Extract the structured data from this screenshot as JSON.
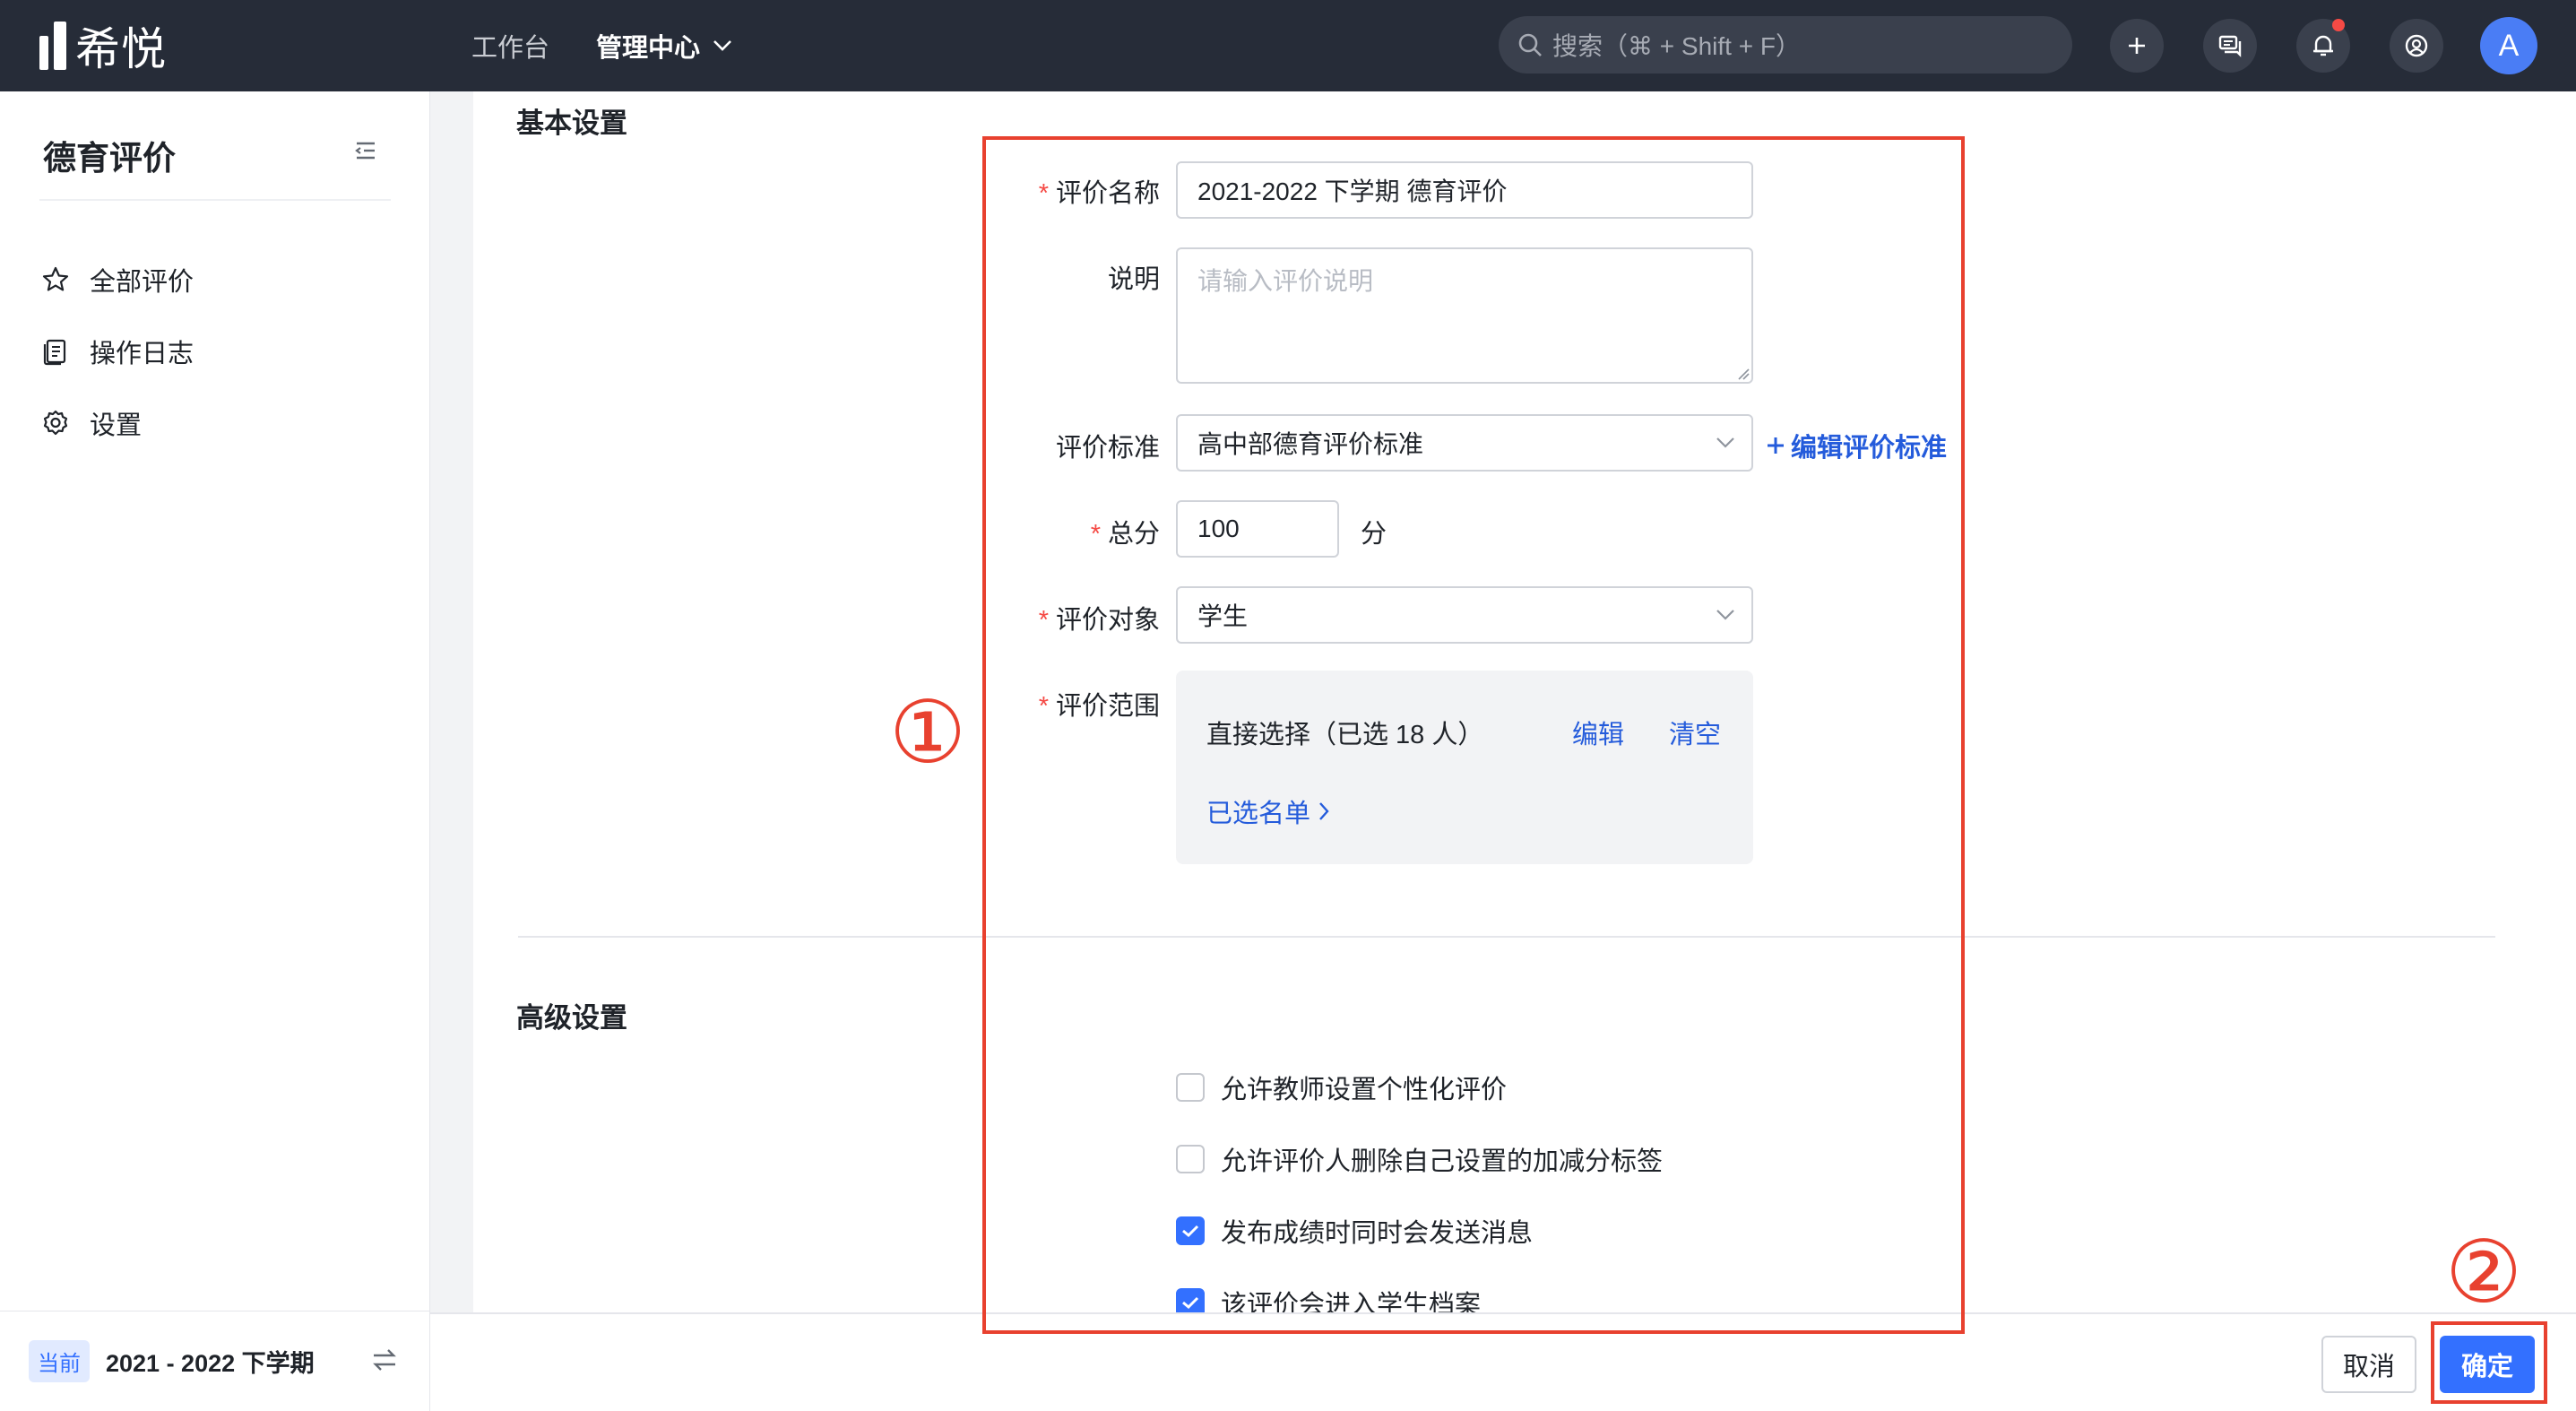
{
  "app": {
    "logo_text": "希悦"
  },
  "nav": {
    "workbench": "工作台",
    "admin": "管理中心"
  },
  "search": {
    "placeholder": "搜索（⌘ + Shift + F）"
  },
  "user": {
    "avatar_letter": "A"
  },
  "sidebar": {
    "title": "德育评价",
    "items": [
      {
        "label": "全部评价",
        "icon": "star-icon"
      },
      {
        "label": "操作日志",
        "icon": "log-icon"
      },
      {
        "label": "设置",
        "icon": "gear-icon"
      }
    ],
    "footer": {
      "badge": "当前",
      "term": "2021 - 2022 下学期"
    }
  },
  "form": {
    "basic_title": "基本设置",
    "name": {
      "label": "评价名称",
      "value": "2021-2022 下学期 德育评价"
    },
    "desc": {
      "label": "说明",
      "placeholder": "请输入评价说明"
    },
    "standard": {
      "label": "评价标准",
      "value": "高中部德育评价标准",
      "edit_link": "编辑评价标准"
    },
    "total": {
      "label": "总分",
      "value": "100",
      "unit": "分"
    },
    "target": {
      "label": "评价对象",
      "value": "学生"
    },
    "scope": {
      "label": "评价范围",
      "text": "直接选择（已选 18 人）",
      "edit": "编辑",
      "clear": "清空",
      "list": "已选名单"
    },
    "advanced_title": "高级设置",
    "options": [
      {
        "label": "允许教师设置个性化评价",
        "checked": false
      },
      {
        "label": "允许评价人删除自己设置的加减分标签",
        "checked": false
      },
      {
        "label": "发布成绩时同时会发送消息",
        "checked": true
      },
      {
        "label": "该评价会进入学生档案",
        "checked": true
      }
    ]
  },
  "footer": {
    "cancel": "取消",
    "confirm": "确定"
  },
  "annotations": {
    "one": "①",
    "two": "②"
  },
  "colors": {
    "primary": "#3370ff",
    "link": "#245bdb",
    "annotation": "#e8412f",
    "topbar": "#262c38"
  }
}
